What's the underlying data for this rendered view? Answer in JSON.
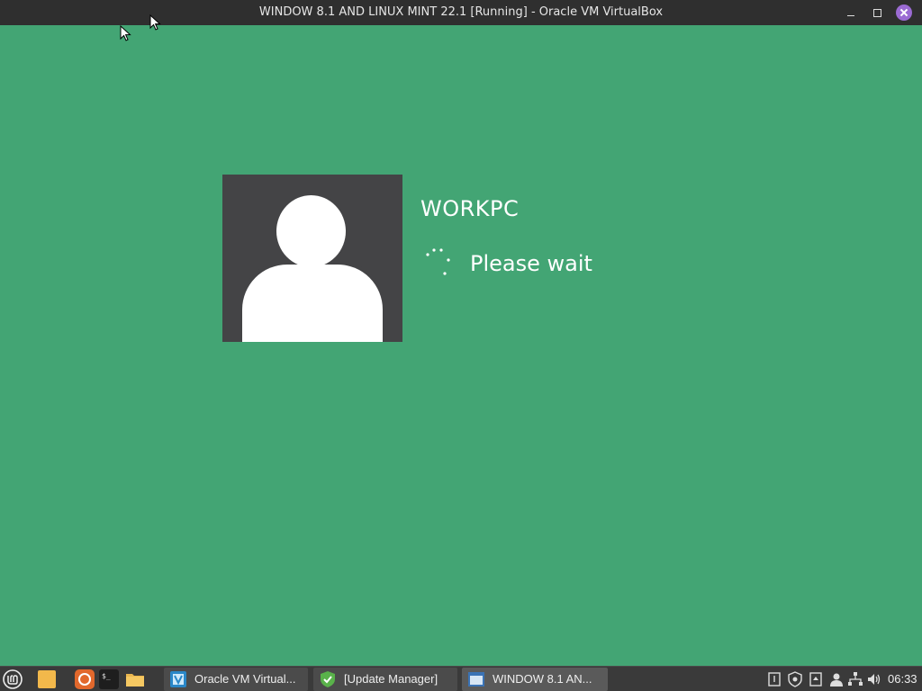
{
  "window": {
    "title": "WINDOW 8.1 AND LINUX MINT 22.1 [Running] - Oracle VM VirtualBox",
    "controls": [
      "minimize",
      "maximize",
      "close"
    ]
  },
  "login": {
    "username": "WORKPC",
    "status": "Please wait",
    "background_color": "#43a574"
  },
  "taskbar": {
    "launchers": [
      "menu-icon",
      "files-icon",
      "firefox-icon",
      "terminal-icon",
      "folder-icon"
    ],
    "tasks": [
      {
        "label": "Oracle VM Virtual...",
        "icon": "virtualbox-icon"
      },
      {
        "label": "[Update Manager]",
        "icon": "update-manager-icon"
      },
      {
        "label": "WINDOW 8.1 AN...",
        "icon": "vm-window-icon"
      }
    ],
    "tray": [
      "notes-icon",
      "shield-icon",
      "drive-icon",
      "user-icon",
      "network-icon",
      "volume-icon"
    ],
    "clock": "06:33"
  }
}
